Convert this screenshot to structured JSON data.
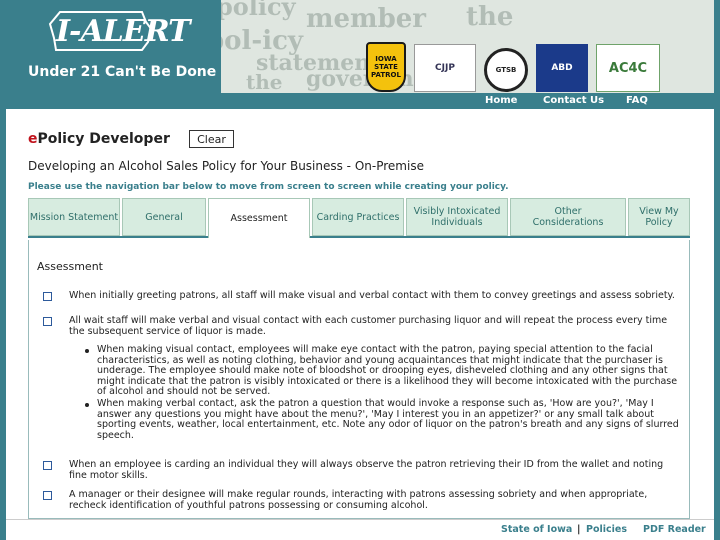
{
  "header": {
    "logo_text": "I-ALERT",
    "tagline": "Under 21 Can't Be Done",
    "background_words": [
      "policy",
      "member",
      "the",
      "pol-icy",
      "statement",
      "the",
      "government"
    ],
    "badges": {
      "patrol": "IOWA STATE PATROL",
      "cjtp": "CJJP",
      "gtsb": "GTSB",
      "abd": "ABD",
      "ac4c": "AC4C"
    }
  },
  "topnav": {
    "home": "Home",
    "contact": "Contact Us",
    "faq": "FAQ"
  },
  "page": {
    "title_e": "e",
    "title_rest": "Policy Developer",
    "clear_label": "Clear",
    "subtitle": "Developing an Alcohol Sales Policy for Your Business - On-Premise",
    "instruction": "Please use the navigation bar below to move from screen to screen while creating your policy."
  },
  "tabs": [
    {
      "label": "Mission Statement"
    },
    {
      "label": "General"
    },
    {
      "label": "Assessment"
    },
    {
      "label": "Carding Practices"
    },
    {
      "label": "Visibly Intoxicated Individuals"
    },
    {
      "label": "Other Considerations"
    },
    {
      "label": "View My Policy"
    }
  ],
  "section": {
    "title": "Assessment",
    "items": [
      "When initially greeting patrons, all staff will make visual and verbal contact with them to convey greetings and assess sobriety.",
      "All wait staff will make verbal and visual contact with each customer purchasing liquor and will repeat the process every time the subsequent service of liquor is made.",
      "When an employee is carding an individual they will always observe the patron retrieving their ID from the wallet and noting fine motor skills.",
      "A manager or their designee will make regular rounds, interacting with patrons assessing sobriety and when appropriate, recheck identification of youthful patrons possessing or consuming alcohol."
    ],
    "bullets": [
      "When making visual contact, employees will make eye contact with the patron, paying special attention to the facial characteristics, as well as noting clothing, behavior and young acquaintances that might indicate that the purchaser is underage. The employee should make note of bloodshot or drooping eyes, disheveled clothing and any other signs that might indicate that the patron is visibly intoxicated or there is a likelihood they will become intoxicated with the purchase of alcohol and should not be served.",
      "When making verbal contact, ask the patron a question that would invoke a response such as, 'How are you?', 'May I answer any questions you might have about the menu?', 'May I interest you in an appetizer?' or any small talk about sporting events, weather, local entertainment, etc. Note any odor of liquor on the patron's breath and any signs of slurred speech."
    ]
  },
  "footer": {
    "state": "State of Iowa",
    "sep": "|",
    "policies": "Policies",
    "pdf": "PDF Reader"
  },
  "colors": {
    "teal": "#3a7f8c",
    "tab_bg": "#d7ece0",
    "title_red": "#c0121c"
  }
}
